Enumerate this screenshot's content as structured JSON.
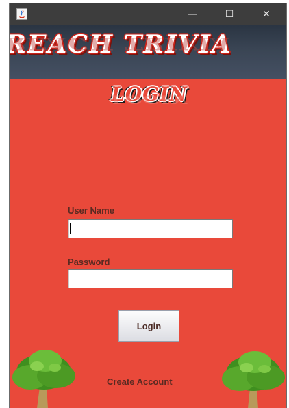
{
  "window": {
    "title": "",
    "controls": {
      "minimize": "—",
      "maximize": "☐",
      "close": "✕"
    }
  },
  "banner": {
    "title": "REACH TRIVIA"
  },
  "login_form": {
    "heading": "LOGIN",
    "username_label": "User Name",
    "username_value": "",
    "password_label": "Password",
    "password_value": "",
    "login_button": "Login",
    "create_account_link": "Create Account"
  },
  "colors": {
    "background": "#e9493a",
    "banner": "#3a4554",
    "titlebar": "#3d3d3d",
    "label_text": "#5a2a22"
  },
  "icons": {
    "app": "java-coffee-icon",
    "decoration_left": "tree-icon",
    "decoration_right": "tree-icon"
  }
}
